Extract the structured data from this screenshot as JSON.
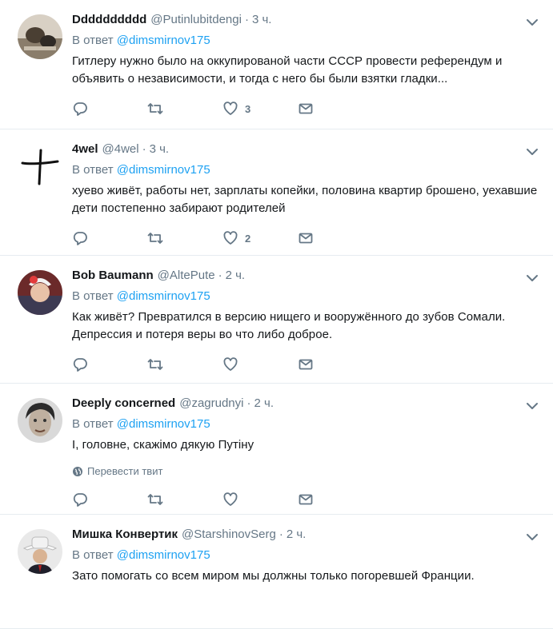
{
  "labels": {
    "reply_prefix": "В ответ",
    "translate": "Перевести твит"
  },
  "colors": {
    "link": "#1da1f2",
    "muted": "#657786",
    "text": "#14171a",
    "border": "#e6ecf0"
  },
  "tweets": [
    {
      "name": "Dddddddddd",
      "handle": "@Putinlubitdengi",
      "time": "3 ч.",
      "reply_to": "@dimsmirnov175",
      "text": "Гитлеру нужно было на оккупированой части СССР провести референдум и объявить о независимости, и тогда с него бы были взятки гладки...",
      "likes": "3",
      "avatar": "photo-avatar-1"
    },
    {
      "name": "4wel",
      "handle": "@4wel",
      "time": "3 ч.",
      "reply_to": "@dimsmirnov175",
      "text": "хуево живёт, работы нет, зарплаты копейки, половина квартир брошено, уехавшие дети постепенно забирают родителей",
      "likes": "2",
      "avatar": "cross-sketch-avatar"
    },
    {
      "name": "Bob Baumann",
      "handle": "@AltePute",
      "time": "2 ч.",
      "reply_to": "@dimsmirnov175",
      "text": "Как живёт? Превратился в версию нищего и вооружённого до зубов Сомали. Депрессия и потеря веры во что либо доброе.",
      "likes": "",
      "avatar": "photo-avatar-3"
    },
    {
      "name": "Deeply concerned",
      "handle": "@zagrudnyi",
      "time": "2 ч.",
      "reply_to": "@dimsmirnov175",
      "text": "І, головне, скажімо дякую Путіну",
      "likes": "",
      "avatar": "portrait-avatar-4"
    },
    {
      "name": "Мишка Конвертик",
      "handle": "@StarshinovSerg",
      "time": "2 ч.",
      "reply_to": "@dimsmirnov175",
      "text": "Зато помогать со всем миром мы должны только погоревшей Франции.",
      "likes": "",
      "avatar": "hat-avatar-5"
    }
  ]
}
